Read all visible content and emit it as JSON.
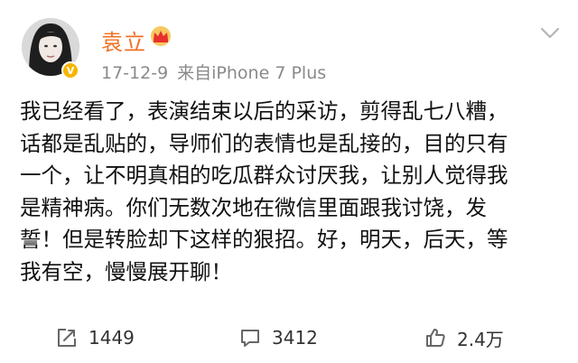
{
  "post": {
    "author": "袁立",
    "date": "17-12-9",
    "source": "来自iPhone 7 Plus",
    "content_lines": [
      "我已经看了，表演结束以后的采访，剪得乱七八糟，",
      "话都是乱贴的，导师们的表情也是乱接的，目的只有",
      "一个，让不明真相的吃瓜群众讨厌我，让别人觉得我",
      "是精神病。你们无数次地在微信里面跟我讨饶，发",
      "誓！但是转脸却下这样的狠招。好，明天，后天，等",
      "我有空，慢慢展开聊！"
    ],
    "icons": {
      "avatar": "avatar-photo",
      "badge": "verified-badge",
      "crown": "crown-icon",
      "more": "chevron-down-icon",
      "repost": "repost-icon",
      "comment": "comment-icon",
      "like": "like-icon"
    }
  },
  "actions": {
    "repost_count": "1449",
    "comment_count": "3412",
    "like_count": "2.4万"
  },
  "colors": {
    "username": "#f26f21",
    "meta": "#8a8a8a",
    "text": "#111111",
    "badge": "#f7b500"
  }
}
